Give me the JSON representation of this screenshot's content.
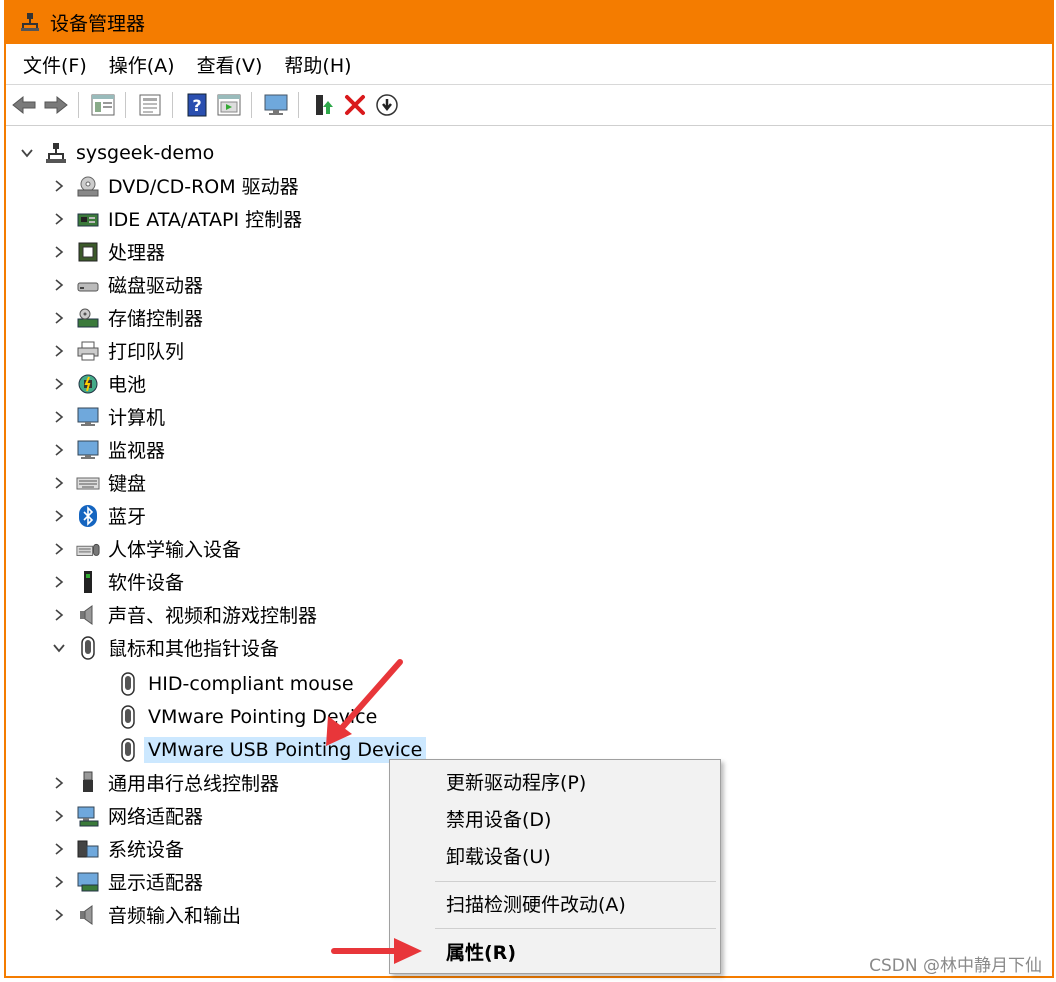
{
  "window": {
    "title": "设备管理器"
  },
  "menu": [
    "文件(F)",
    "操作(A)",
    "查看(V)",
    "帮助(H)"
  ],
  "toolbar": {
    "icons": [
      "back-arrow-icon",
      "forward-arrow-icon",
      "show-hide-tree-icon",
      "properties-sheet-icon",
      "help-icon",
      "view-icon",
      "monitor-scan-icon",
      "update-driver-icon",
      "uninstall-x-icon",
      "download-circle-icon"
    ]
  },
  "tree": {
    "root": "sysgeek-demo",
    "categories": [
      {
        "label": "DVD/CD-ROM 驱动器",
        "icon": "dvd-drive-icon"
      },
      {
        "label": "IDE ATA/ATAPI 控制器",
        "icon": "ide-controller-icon"
      },
      {
        "label": "处理器",
        "icon": "processor-icon"
      },
      {
        "label": "磁盘驱动器",
        "icon": "disk-drive-icon"
      },
      {
        "label": "存储控制器",
        "icon": "storage-controller-icon"
      },
      {
        "label": "打印队列",
        "icon": "printer-icon"
      },
      {
        "label": "电池",
        "icon": "battery-icon"
      },
      {
        "label": "计算机",
        "icon": "computer-icon"
      },
      {
        "label": "监视器",
        "icon": "monitor-icon"
      },
      {
        "label": "键盘",
        "icon": "keyboard-icon"
      },
      {
        "label": "蓝牙",
        "icon": "bluetooth-icon"
      },
      {
        "label": "人体学输入设备",
        "icon": "hid-icon"
      },
      {
        "label": "软件设备",
        "icon": "software-device-icon"
      },
      {
        "label": "声音、视频和游戏控制器",
        "icon": "speaker-icon"
      },
      {
        "label": "鼠标和其他指针设备",
        "icon": "mouse-icon",
        "expanded": true
      },
      {
        "label": "通用串行总线控制器",
        "icon": "usb-icon"
      },
      {
        "label": "网络适配器",
        "icon": "network-adapter-icon"
      },
      {
        "label": "系统设备",
        "icon": "system-device-icon"
      },
      {
        "label": "显示适配器",
        "icon": "display-adapter-icon"
      },
      {
        "label": "音频输入和输出",
        "icon": "audio-io-icon"
      }
    ],
    "mouse_children": [
      "HID-compliant mouse",
      "VMware Pointing Device",
      "VMware USB Pointing Device"
    ],
    "selected_child": "VMware USB Pointing Device"
  },
  "context_menu": {
    "items": [
      "更新驱动程序(P)",
      "禁用设备(D)",
      "卸载设备(U)",
      "扫描检测硬件改动(A)",
      "属性(R)"
    ]
  },
  "colors": {
    "title_bar": "#f47c00",
    "selection": "#cce8ff",
    "annotation_arrow": "#e8363a"
  },
  "watermark": "CSDN @林中静月下仙"
}
